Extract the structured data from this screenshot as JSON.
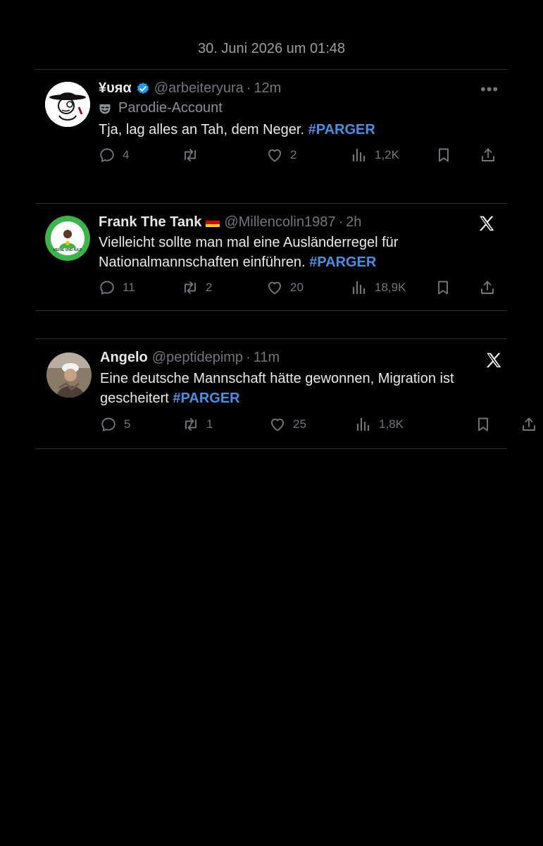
{
  "timestamp": "30. Juni 2026 um 01:48",
  "tweets": [
    {
      "name": "¥υяα",
      "handle": "@arbeiteryura",
      "separator": "·",
      "time": "12m",
      "parody_label": "Parodie-Account",
      "text": "Tja, lag alles an Tah, dem Neger.",
      "hashtag": "#PARGER",
      "replies": "4",
      "retweets": "",
      "likes": "2",
      "views": "1,2K",
      "more": "•••"
    },
    {
      "name": "Frank The Tank",
      "handle": "@Millencolin1987",
      "separator": "·",
      "time": "2h",
      "text": "Vielleicht sollte man mal eine Ausländerregel für Nationalmannschaften einführen.",
      "hashtag": "#PARGER",
      "replies": "11",
      "retweets": "2",
      "likes": "20",
      "views": "18,9K",
      "avatar_text": "MEINE UND NAZI"
    },
    {
      "name": "Angelo",
      "handle": "@peptidepimp",
      "separator": "·",
      "time": "11m",
      "text": "Eine deutsche Mannschaft hätte gewonnen, Migration ist gescheitert",
      "hashtag": "#PARGER",
      "replies": "5",
      "retweets": "1",
      "likes": "25",
      "views": "1,8K"
    }
  ],
  "colors": {
    "background": "#000000",
    "hashtag": "#4a90e2",
    "muted": "#71767b",
    "verified": "#1d9bf0"
  },
  "icons": [
    "verified-badge-icon",
    "parody-mask-icon",
    "reply-icon",
    "retweet-icon",
    "like-icon",
    "views-icon",
    "bookmark-icon",
    "share-icon",
    "x-logo-icon",
    "more-icon"
  ]
}
